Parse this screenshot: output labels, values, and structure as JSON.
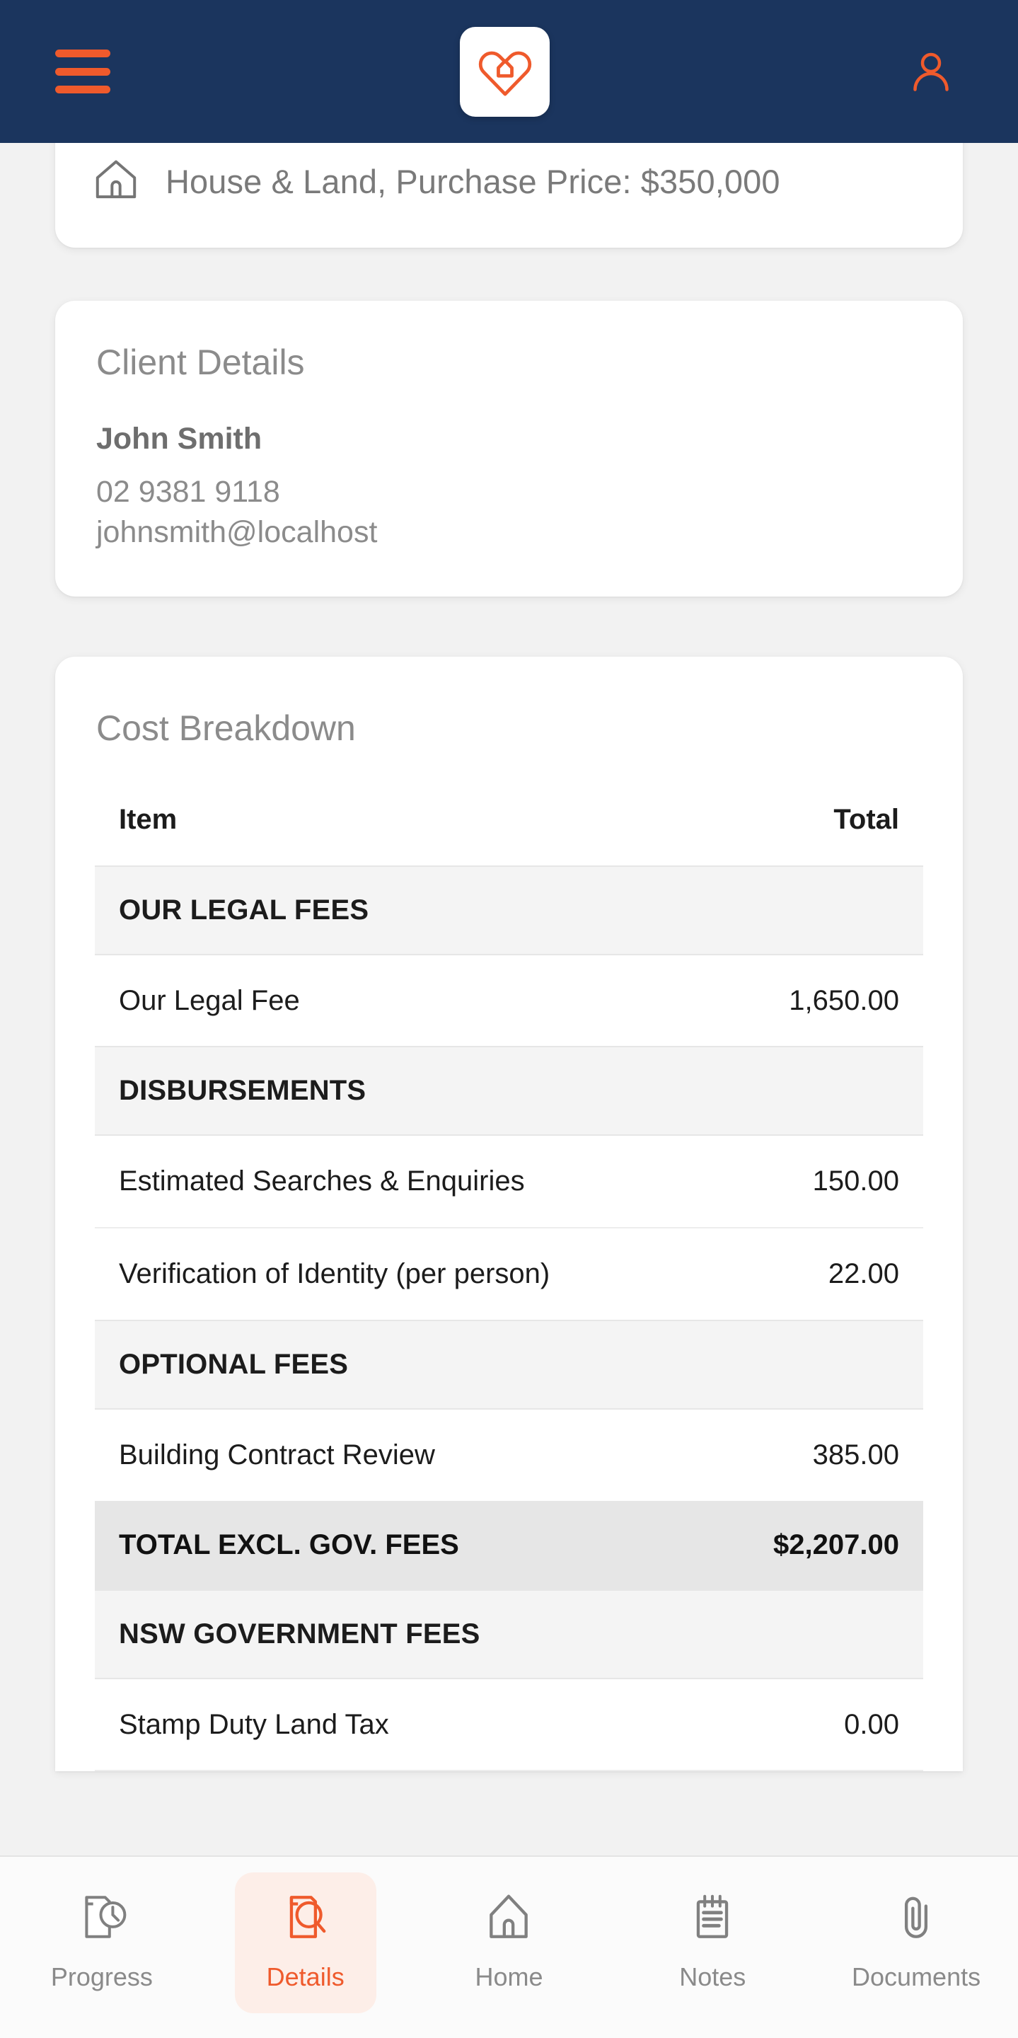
{
  "theme": {
    "navy": "#1b355e",
    "accent": "#ef5a2c",
    "accent_soft": "#fdeee8",
    "page_bg": "#f2f2f2",
    "card_bg": "#ffffff",
    "group_row_bg": "#f4f4f4",
    "total_row_bg": "#e6e6e6",
    "muted_text": "#8b8b8b"
  },
  "appbar": {
    "menu_icon": "hamburger-menu-icon",
    "logo_icon": "heart-house-logo-icon",
    "account_icon": "user-account-icon"
  },
  "property": {
    "icon": "house-icon",
    "summary": "House & Land, Purchase Price: $350,000"
  },
  "client": {
    "title": "Client Details",
    "name": "John Smith",
    "phone": "02 9381 9118",
    "email": "johnsmith@localhost"
  },
  "cost": {
    "title": "Cost Breakdown",
    "columns": {
      "item": "Item",
      "total": "Total"
    },
    "rows": [
      {
        "type": "group",
        "label": "OUR LEGAL FEES",
        "amount": ""
      },
      {
        "type": "item",
        "label": "Our Legal Fee",
        "amount": "1,650.00"
      },
      {
        "type": "group",
        "label": "DISBURSEMENTS",
        "amount": ""
      },
      {
        "type": "item",
        "label": "Estimated Searches & Enquiries",
        "amount": "150.00"
      },
      {
        "type": "item",
        "label": "Verification of Identity (per person)",
        "amount": "22.00"
      },
      {
        "type": "group",
        "label": "OPTIONAL FEES",
        "amount": ""
      },
      {
        "type": "item",
        "label": "Building Contract Review",
        "amount": "385.00"
      },
      {
        "type": "total",
        "label": "TOTAL EXCL. GOV. FEES",
        "amount": "$2,207.00"
      },
      {
        "type": "group",
        "label": "NSW GOVERNMENT FEES",
        "amount": ""
      },
      {
        "type": "item",
        "label": "Stamp Duty Land Tax",
        "amount": "0.00"
      }
    ]
  },
  "bottomnav": {
    "items": [
      {
        "label": "Progress",
        "icon": "document-clock-icon",
        "active": false
      },
      {
        "label": "Details",
        "icon": "document-search-icon",
        "active": true
      },
      {
        "label": "Home",
        "icon": "house-outline-icon",
        "active": false
      },
      {
        "label": "Notes",
        "icon": "notepad-icon",
        "active": false
      },
      {
        "label": "Documents",
        "icon": "paperclip-icon",
        "active": false
      }
    ]
  }
}
